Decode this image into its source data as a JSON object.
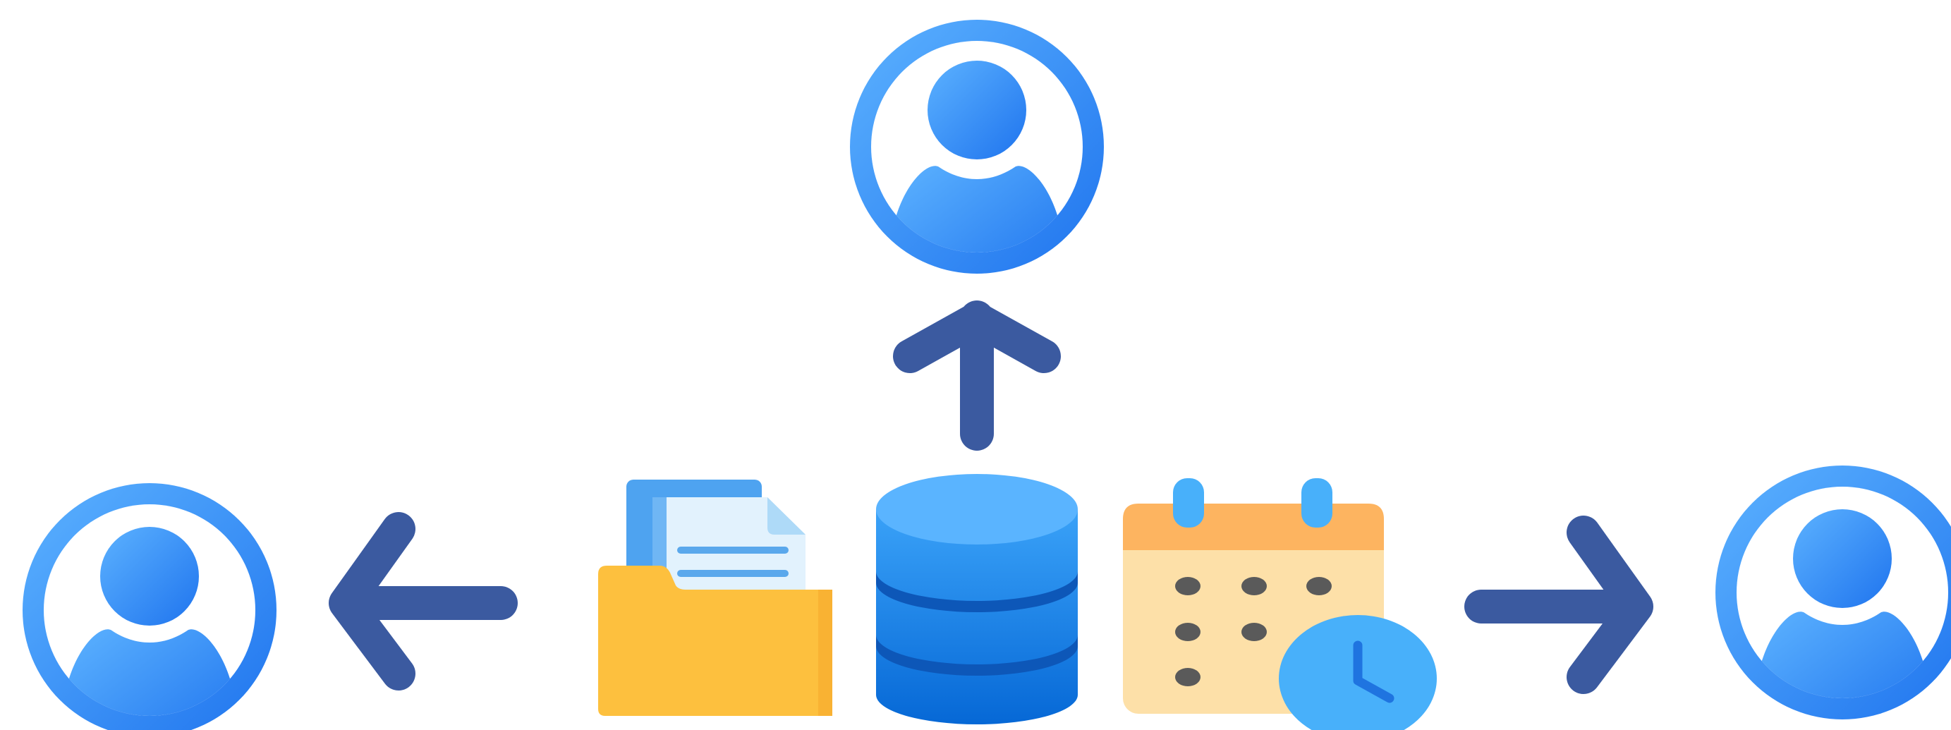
{
  "diagram": {
    "nodes": [
      {
        "id": "user-top",
        "icon": "user-icon"
      },
      {
        "id": "user-left",
        "icon": "user-icon"
      },
      {
        "id": "user-right",
        "icon": "user-icon"
      },
      {
        "id": "folder",
        "icon": "folder-documents-icon"
      },
      {
        "id": "database",
        "icon": "database-icon"
      },
      {
        "id": "calendar",
        "icon": "calendar-clock-icon"
      }
    ],
    "edges": [
      {
        "from": "database",
        "to": "user-top",
        "direction": "up"
      },
      {
        "from": "folder",
        "to": "user-left",
        "direction": "left"
      },
      {
        "from": "calendar",
        "to": "user-right",
        "direction": "right"
      }
    ]
  },
  "colors": {
    "user_light": "#55adff",
    "user_dark": "#1f78f0",
    "arrow": "#3b5aa0",
    "folder_yellow": "#fdc03e",
    "folder_back": "#4ea3f0",
    "doc_paper": "#dff0fc",
    "db_top": "#5ab4ff",
    "db_dark_bands": "#0d57b8",
    "calendar_header": "#fdb460",
    "calendar_body": "#fde0a8",
    "clock": "#48b0fa"
  }
}
